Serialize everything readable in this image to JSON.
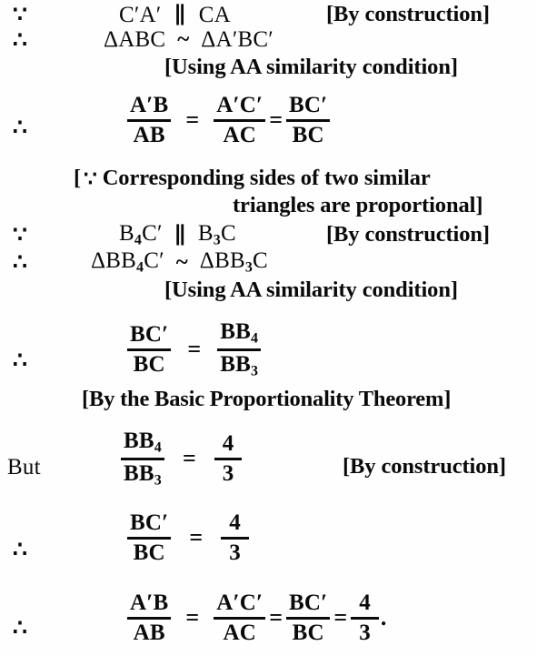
{
  "document": {
    "type": "geometry-proof",
    "background_color": "#fefefe",
    "text_color": "#0a0a0a"
  },
  "symbols": {
    "because": "∵",
    "therefore": "∴",
    "parallel": "∥",
    "similar": "~",
    "triangle": "Δ",
    "equals": "=",
    "period": "."
  },
  "lines": {
    "l1": {
      "marker": "∵",
      "statement_left": "C′A′",
      "relation": "∥",
      "statement_right": "CA",
      "reason": "[By construction]"
    },
    "l2": {
      "marker": "∴",
      "statement_left": "ΔABC",
      "relation": "~",
      "statement_right": "ΔA′BC′"
    },
    "l3": {
      "reason": "[Using AA similarity condition]"
    },
    "l4": {
      "marker": "∴",
      "f1_num": "A′B",
      "f1_den": "AB",
      "eq1": "=",
      "f2_num": "A′C′",
      "f2_den": "AC",
      "eq2": "=",
      "f3_num": "BC′",
      "f3_den": "BC"
    },
    "l5": {
      "open": "[",
      "marker": "∵",
      "text": "Corresponding sides of two similar"
    },
    "l6": {
      "text": "triangles are proportional]"
    },
    "l7": {
      "marker": "∵",
      "statement_left_base": "B",
      "statement_left_sub": "4",
      "statement_left_tail": "C′",
      "relation": "∥",
      "statement_right_base": "B",
      "statement_right_sub": "3",
      "statement_right_tail": "C",
      "reason": "[By construction]"
    },
    "l8": {
      "marker": "∴",
      "statement_left_base": "ΔBB",
      "statement_left_sub": "4",
      "statement_left_tail": "C′",
      "relation": "~",
      "statement_right_base": "ΔBB",
      "statement_right_sub": "3",
      "statement_right_tail": "C"
    },
    "l9": {
      "reason": "[Using AA similarity condition]"
    },
    "l10": {
      "marker": "∴",
      "f1_num": "BC′",
      "f1_den": "BC",
      "eq1": "=",
      "f2_num_base": "BB",
      "f2_num_sub": "4",
      "f2_den_base": "BB",
      "f2_den_sub": "3"
    },
    "l11": {
      "reason": "[By the Basic Proportionality Theorem]"
    },
    "l12": {
      "marker": "But",
      "f1_num_base": "BB",
      "f1_num_sub": "4",
      "f1_den_base": "BB",
      "f1_den_sub": "3",
      "eq1": "=",
      "f2_num": "4",
      "f2_den": "3",
      "reason": "[By construction]"
    },
    "l13": {
      "marker": "∴",
      "f1_num": "BC′",
      "f1_den": "BC",
      "eq1": "=",
      "f2_num": "4",
      "f2_den": "3"
    },
    "l14": {
      "marker": "∴",
      "f1_num": "A′B",
      "f1_den": "AB",
      "eq1": "=",
      "f2_num": "A′C′",
      "f2_den": "AC",
      "eq2": "=",
      "f3_num": "BC′",
      "f3_den": "BC",
      "eq3": "=",
      "f4_num": "4",
      "f4_den": "3",
      "period": "."
    }
  }
}
